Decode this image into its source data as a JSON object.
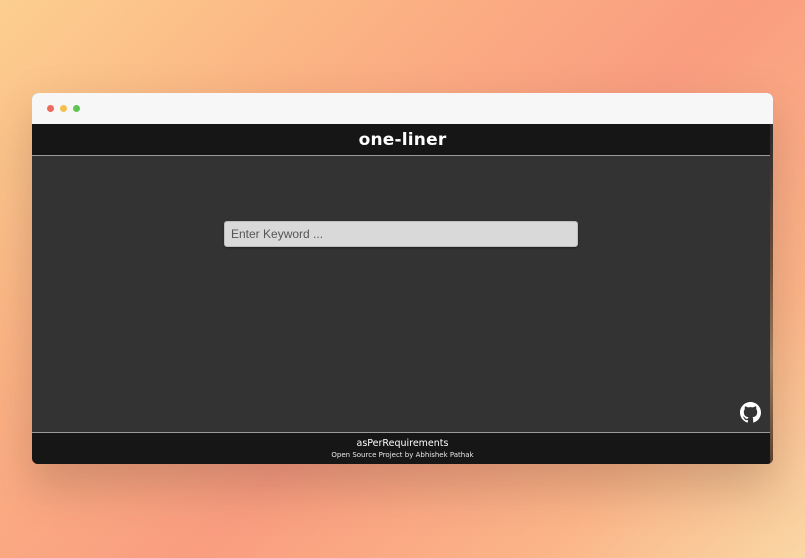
{
  "window": {
    "controls": [
      "close",
      "minimize",
      "maximize"
    ]
  },
  "header": {
    "title": "one-liner"
  },
  "search": {
    "placeholder": "Enter Keyword ...",
    "value": ""
  },
  "links": {
    "github_icon": "github-icon"
  },
  "footer": {
    "title": "asPerRequirements",
    "subtitle": "Open Source Project by Abhishek Pathak"
  },
  "colors": {
    "header_bg": "#161616",
    "main_bg": "#333333",
    "input_bg": "#d9d9d9",
    "text": "#ffffff"
  }
}
